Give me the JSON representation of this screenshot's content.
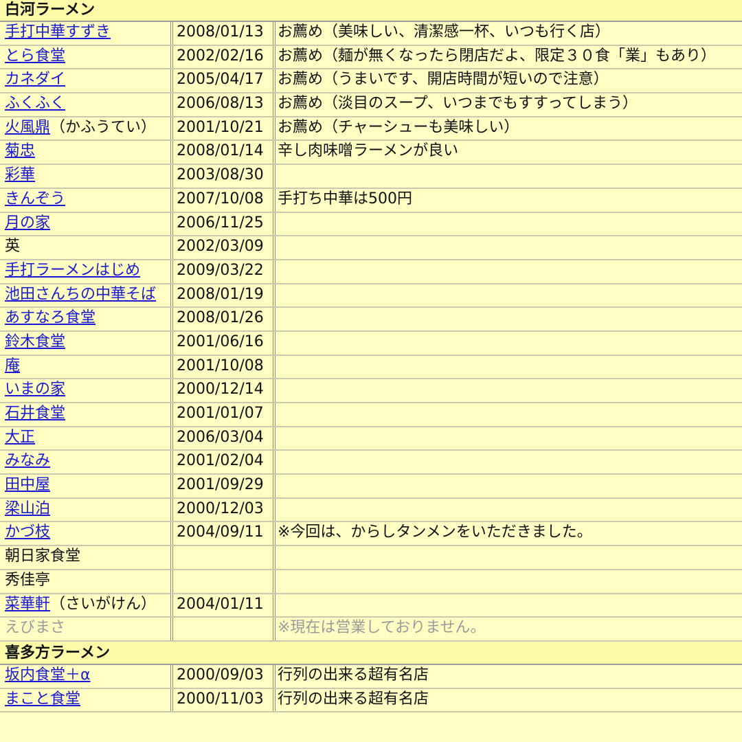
{
  "sections": [
    {
      "title": "白河ラーメン",
      "rows": [
        {
          "link": "手打中華すずき",
          "suffix": "",
          "date": "2008/01/13",
          "note": "お薦め（美味しい、清潔感一杯、いつも行く店）"
        },
        {
          "link": "とら食堂",
          "suffix": "",
          "date": "2002/02/16",
          "note": "お薦め（麺が無くなったら閉店だよ、限定３０食「業」もあり）"
        },
        {
          "link": "カネダイ",
          "suffix": "",
          "date": "2005/04/17",
          "note": "お薦め（うまいです、開店時間が短いので注意）"
        },
        {
          "link": "ふくふく",
          "suffix": "",
          "date": "2006/08/13",
          "note": "お薦め（淡目のスープ、いつまでもすすってしまう）"
        },
        {
          "link": "火風鼎",
          "suffix": "（かふうてい）",
          "date": "2001/10/21",
          "note": "お薦め（チャーシューも美味しい）"
        },
        {
          "link": "菊忠",
          "suffix": "",
          "date": "2008/01/14",
          "note": "辛し肉味噌ラーメンが良い"
        },
        {
          "link": "彩華",
          "suffix": "",
          "date": "2003/08/30",
          "note": ""
        },
        {
          "link": "きんぞう",
          "suffix": "",
          "date": "2007/10/08",
          "note": "手打ち中華は500円"
        },
        {
          "link": "月の家",
          "suffix": "",
          "date": "2006/11/25",
          "note": ""
        },
        {
          "plain": "英",
          "date": "2002/03/09",
          "note": ""
        },
        {
          "link": "手打ラーメンはじめ",
          "suffix": "",
          "date": "2009/03/22",
          "note": ""
        },
        {
          "link": "池田さんちの中華そば",
          "suffix": "",
          "date": "2008/01/19",
          "note": ""
        },
        {
          "link": "あすなろ食堂",
          "suffix": "",
          "date": "2008/01/26",
          "note": ""
        },
        {
          "link": "鈴木食堂",
          "suffix": "",
          "date": "2001/06/16",
          "note": ""
        },
        {
          "link": "庵",
          "suffix": "",
          "date": "2001/10/08",
          "note": ""
        },
        {
          "link": "いまの家",
          "suffix": "",
          "date": "2000/12/14",
          "note": ""
        },
        {
          "link": "石井食堂",
          "suffix": "",
          "date": "2001/01/07",
          "note": ""
        },
        {
          "link": "大正",
          "suffix": "",
          "date": "2006/03/04",
          "note": ""
        },
        {
          "link": "みなみ",
          "suffix": "",
          "date": "2001/02/04",
          "note": ""
        },
        {
          "link": "田中屋",
          "suffix": "",
          "date": "2001/09/29",
          "note": ""
        },
        {
          "link": "梁山泊",
          "suffix": "",
          "date": "2000/12/03",
          "note": ""
        },
        {
          "link": "かづ枝",
          "suffix": "",
          "date": "2004/09/11",
          "note": "※今回は、からしタンメンをいただきました。"
        },
        {
          "plain": "朝日家食堂",
          "date": "",
          "note": ""
        },
        {
          "plain": "秀佳亭",
          "date": "",
          "note": ""
        },
        {
          "link": "菜華軒",
          "suffix": "（さいがけん）",
          "date": "2004/01/11",
          "note": ""
        },
        {
          "muted": "えびまさ",
          "date": "",
          "note": "※現在は営業しておりません。"
        }
      ]
    },
    {
      "title": "喜多方ラーメン",
      "rows": [
        {
          "link": "坂内食堂＋α",
          "suffix": "",
          "date": "2000/09/03",
          "note": "行列の出来る超有名店"
        },
        {
          "link": "まこと食堂",
          "suffix": "",
          "date": "2000/11/03",
          "note": "行列の出来る超有名店"
        }
      ]
    }
  ]
}
